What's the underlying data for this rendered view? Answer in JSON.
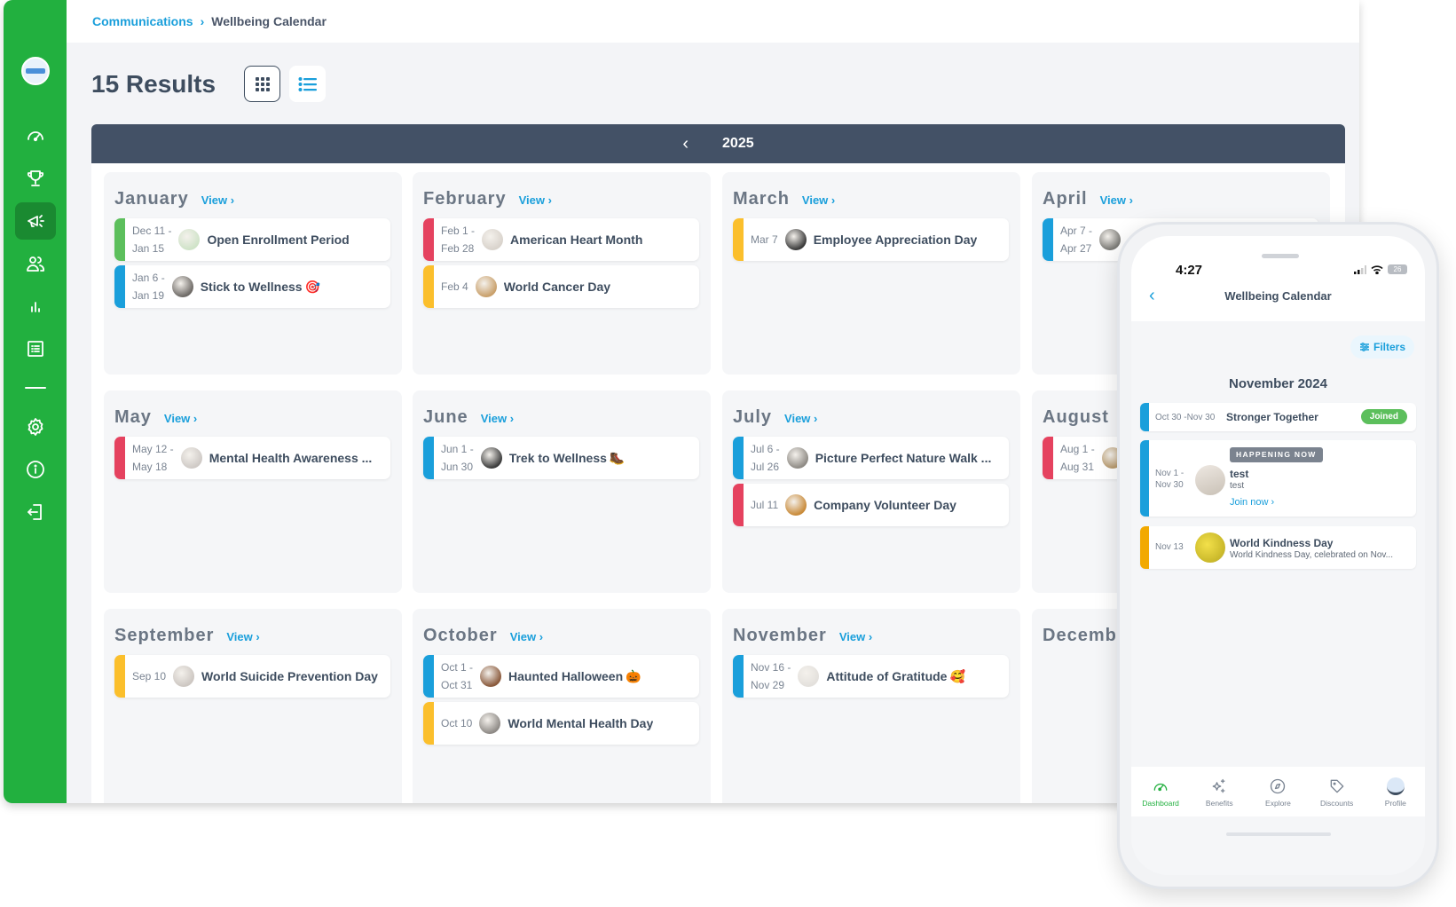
{
  "breadcrumb": {
    "parent": "Communications",
    "current": "Wellbeing Calendar"
  },
  "results": {
    "title": "15 Results",
    "grid_view_icon": "grid-icon",
    "list_view_icon": "list-icon"
  },
  "year_nav": {
    "prev_icon": "chevron-left-icon",
    "prev_glyph": "‹",
    "year": "2025"
  },
  "sidebar": {
    "items": [
      {
        "name": "dashboard",
        "icon": "speedometer-icon",
        "active": false
      },
      {
        "name": "challenges",
        "icon": "trophy-icon",
        "active": false
      },
      {
        "name": "communications",
        "icon": "megaphone-icon",
        "active": true
      },
      {
        "name": "users",
        "icon": "users-icon",
        "active": false
      },
      {
        "name": "reports",
        "icon": "bar-chart-icon",
        "active": false
      },
      {
        "name": "content",
        "icon": "list-icon",
        "active": false
      },
      {
        "name": "settings",
        "icon": "gear-icon",
        "active": false
      },
      {
        "name": "info",
        "icon": "info-icon",
        "active": false
      },
      {
        "name": "logout",
        "icon": "logout-icon",
        "active": false
      }
    ]
  },
  "view_label": "View ›",
  "colors": {
    "green": "#22b03f",
    "blue": "#1a9fdb",
    "red": "#e5425f",
    "yellow": "#fbbf2c",
    "slate": "#435166"
  },
  "months": [
    {
      "name": "January",
      "events": [
        {
          "date1": "Dec 11 -",
          "date2": "Jan 15",
          "title": "Open Enrollment Period",
          "emoji": "",
          "color": "#5cbf5c",
          "thumb": "#cfe3c8"
        },
        {
          "date1": "Jan 6 -",
          "date2": "Jan 19",
          "title": "Stick to Wellness",
          "emoji": "🎯",
          "color": "#1a9fdb",
          "thumb": "#6e6a66"
        }
      ]
    },
    {
      "name": "February",
      "events": [
        {
          "date1": "Feb 1 -",
          "date2": "Feb 28",
          "title": "American Heart Month",
          "emoji": "",
          "color": "#e5425f",
          "thumb": "#d9d3cc"
        },
        {
          "date1": "Feb 4",
          "date2": "",
          "title": "World Cancer Day",
          "emoji": "",
          "color": "#fbbf2c",
          "thumb": "#c9a06b"
        }
      ]
    },
    {
      "name": "March",
      "events": [
        {
          "date1": "Mar 7",
          "date2": "",
          "title": "Employee Appreciation Day",
          "emoji": "",
          "color": "#fbbf2c",
          "thumb": "#3b3b3b"
        }
      ]
    },
    {
      "name": "April",
      "events": [
        {
          "date1": "Apr 7 -",
          "date2": "Apr 27",
          "title": "",
          "emoji": "",
          "color": "#1a9fdb",
          "thumb": "#7b7a76"
        }
      ]
    },
    {
      "name": "May",
      "events": [
        {
          "date1": "May 12 -",
          "date2": "May 18",
          "title": "Mental Health Awareness ...",
          "emoji": "",
          "color": "#e5425f",
          "thumb": "#cfcac6"
        }
      ]
    },
    {
      "name": "June",
      "events": [
        {
          "date1": "Jun 1 -",
          "date2": "Jun 30",
          "title": "Trek to Wellness",
          "emoji": "🥾",
          "color": "#1a9fdb",
          "thumb": "#3c3c3c"
        }
      ]
    },
    {
      "name": "July",
      "events": [
        {
          "date1": "Jul 6 -",
          "date2": "Jul 26",
          "title": "Picture Perfect Nature Walk ...",
          "emoji": "",
          "color": "#1a9fdb",
          "thumb": "#8f8b85"
        },
        {
          "date1": "Jul 11",
          "date2": "",
          "title": "Company Volunteer Day",
          "emoji": "",
          "color": "#e5425f",
          "thumb": "#c98b3a"
        }
      ]
    },
    {
      "name": "August",
      "events": [
        {
          "date1": "Aug 1 -",
          "date2": "Aug 31",
          "title": "",
          "emoji": "",
          "color": "#e5425f",
          "thumb": "#b89a6e"
        }
      ]
    },
    {
      "name": "September",
      "events": [
        {
          "date1": "Sep 10",
          "date2": "",
          "title": "World Suicide Prevention Day",
          "emoji": "",
          "color": "#fbbf2c",
          "thumb": "#cdc7c2"
        }
      ]
    },
    {
      "name": "October",
      "events": [
        {
          "date1": "Oct 1 -",
          "date2": "Oct 31",
          "title": "Haunted Halloween",
          "emoji": "🎃",
          "color": "#1a9fdb",
          "thumb": "#8a5a3c"
        },
        {
          "date1": "Oct 10",
          "date2": "",
          "title": "World Mental Health Day",
          "emoji": "",
          "color": "#fbbf2c",
          "thumb": "#8e8a86"
        }
      ]
    },
    {
      "name": "November",
      "events": [
        {
          "date1": "Nov 16 -",
          "date2": "Nov 29",
          "title": "Attitude of Gratitude",
          "emoji": "🥰",
          "color": "#1a9fdb",
          "thumb": "#e3e0dc"
        }
      ]
    },
    {
      "name": "December",
      "events": []
    }
  ],
  "phone": {
    "time": "4:27",
    "battery": "26",
    "title": "Wellbeing Calendar",
    "back_glyph": "‹",
    "filters_label": "Filters",
    "month_heading": "November 2024",
    "cards": {
      "c1": {
        "date": "Oct 30 -Nov 30",
        "title": "Stronger Together",
        "badge": "Joined"
      },
      "c2": {
        "badge": "HAPPENING NOW",
        "date1": "Nov 1 -",
        "date2": "Nov 30",
        "title": "test",
        "sub": "test",
        "cta": "Join now ›"
      },
      "c3": {
        "date": "Nov 13",
        "title": "World Kindness Day",
        "sub": "World Kindness Day, celebrated on Nov..."
      }
    },
    "tabs": [
      {
        "label": "Dashboard",
        "icon": "speedometer-icon",
        "active": true
      },
      {
        "label": "Benefits",
        "icon": "sparkles-icon",
        "active": false
      },
      {
        "label": "Explore",
        "icon": "compass-icon",
        "active": false
      },
      {
        "label": "Discounts",
        "icon": "tag-icon",
        "active": false
      },
      {
        "label": "Profile",
        "icon": "avatar-icon",
        "active": false
      }
    ]
  }
}
